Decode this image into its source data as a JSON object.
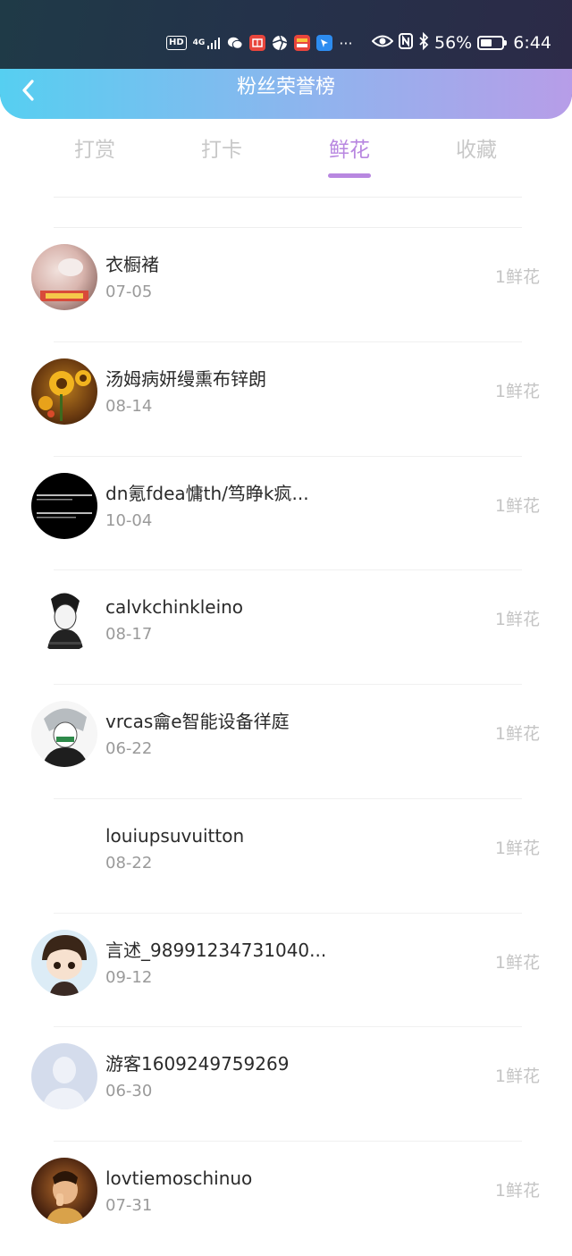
{
  "status_bar": {
    "hd_label": "HD",
    "network_label": "4G",
    "overflow_dots": "···",
    "battery_percent_text": "56%",
    "battery_level": 0.56,
    "time": "6:44"
  },
  "header": {
    "title": "粉丝荣誉榜",
    "back_icon": "chevron-left-icon"
  },
  "tabs": [
    {
      "label": "打赏",
      "active": false
    },
    {
      "label": "打卡",
      "active": false
    },
    {
      "label": "鲜花",
      "active": true
    },
    {
      "label": "收藏",
      "active": false
    }
  ],
  "fans": [
    {
      "name": "衣橱褚",
      "date": "07-05",
      "count": "1鲜花",
      "avatar": "photo-cake"
    },
    {
      "name": "汤姆病妍缦熏布锌朗",
      "date": "08-14",
      "count": "1鲜花",
      "avatar": "photo-sunflower"
    },
    {
      "name": "dn氪fdea慵th/笃睁k疯...",
      "date": "10-04",
      "count": "1鲜花",
      "avatar": "text-black"
    },
    {
      "name": "calvkchinkleino",
      "date": "08-17",
      "count": "1鲜花",
      "avatar": "sketch-person"
    },
    {
      "name": "vrcas龠e智能设备徉庭",
      "date": "06-22",
      "count": "1鲜花",
      "avatar": "sketch-anime"
    },
    {
      "name": "louiupsuvuitton",
      "date": "08-22",
      "count": "1鲜花",
      "avatar": "blank"
    },
    {
      "name": "言述_98991234731040...",
      "date": "09-12",
      "count": "1鲜花",
      "avatar": "cartoon-boy"
    },
    {
      "name": "游客1609249759269",
      "date": "06-30",
      "count": "1鲜花",
      "avatar": "default-person"
    },
    {
      "name": "lovtiemoschinuo",
      "date": "07-31",
      "count": "1鲜花",
      "avatar": "photo-person"
    }
  ]
}
